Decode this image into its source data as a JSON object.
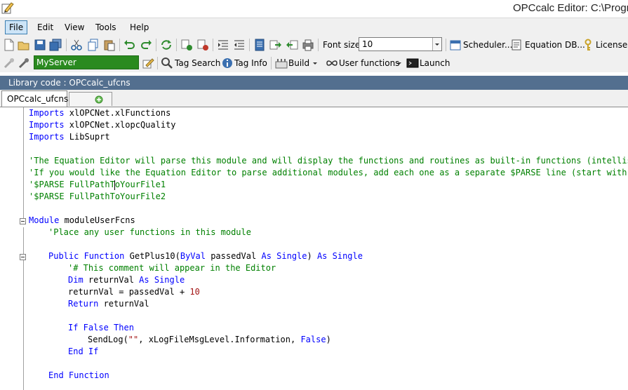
{
  "window": {
    "title": "OPCcalc Editor: C:\\Progra"
  },
  "menu": [
    {
      "label": "File",
      "active": true
    },
    {
      "label": "Edit"
    },
    {
      "label": "View"
    },
    {
      "label": "Tools"
    },
    {
      "label": "Help"
    }
  ],
  "toolbar1": {
    "font_size_label": "Font size",
    "font_size_value": "10",
    "scheduler_label": "Scheduler...",
    "equation_db_label": "Equation DB...",
    "license_label": "License"
  },
  "toolbar2": {
    "server_value": "MyServer",
    "tag_search_label": "Tag Search",
    "tag_info_label": "Tag Info",
    "build_label": "Build",
    "user_functions_label": "User functions",
    "launch_label": "Launch"
  },
  "library_bar": {
    "label": "Library code : OPCcalc_ufcns"
  },
  "tabs": [
    {
      "label": "OPCcalc_ufcns"
    }
  ],
  "code": {
    "l1_kw": "Imports",
    "l1_rest": " xlOPCNet.xlFunctions",
    "l2_kw": "Imports",
    "l2_rest": " xlOPCNet.xlopcQuality",
    "l3_kw": "Imports",
    "l3_rest": " LibSuprt",
    "l5": "'The Equation Editor will parse this module and will display the functions and routines as built-in functions (intellisens",
    "l6": "'If you would like the Equation Editor to parse additional modules, add each one as a separate $PARSE line (start with com",
    "l7a": "'$PARSE FullPathT",
    "l7b": "oYourFile1",
    "l8": "'$PARSE FullPathToYourFile2",
    "l10_kw": "Module",
    "l10_rest": " moduleUserFcns",
    "l11": "'Place any user functions in this module",
    "l13_k1": "Public Function",
    "l13_p1": " GetPlus10(",
    "l13_k2": "ByVal",
    "l13_p2": " passedVal ",
    "l13_k3": "As Single",
    "l13_p3": ") ",
    "l13_k4": "As Single",
    "l14": "'# This comment will appear in the Editor",
    "l15_kw": "Dim",
    "l15_p": " returnVal ",
    "l15_kw2": "As Single",
    "l16_p": "returnVal = passedVal + ",
    "l16_n": "10",
    "l17_kw": "Return",
    "l17_p": " returnVal",
    "l19_kw": "If False Then",
    "l20_p1": "SendLog(",
    "l20_s": "\"\"",
    "l20_p2": ", xLogFileMsgLevel.Information, ",
    "l20_kw": "False",
    "l20_p3": ")",
    "l21_kw": "End If",
    "l23_kw": "End Function"
  },
  "colors": {
    "keyword": "#0000ff",
    "comment": "#008000",
    "number": "#a31515",
    "server_bg": "#2a8a1f",
    "library_bar_bg": "#536f8f"
  }
}
